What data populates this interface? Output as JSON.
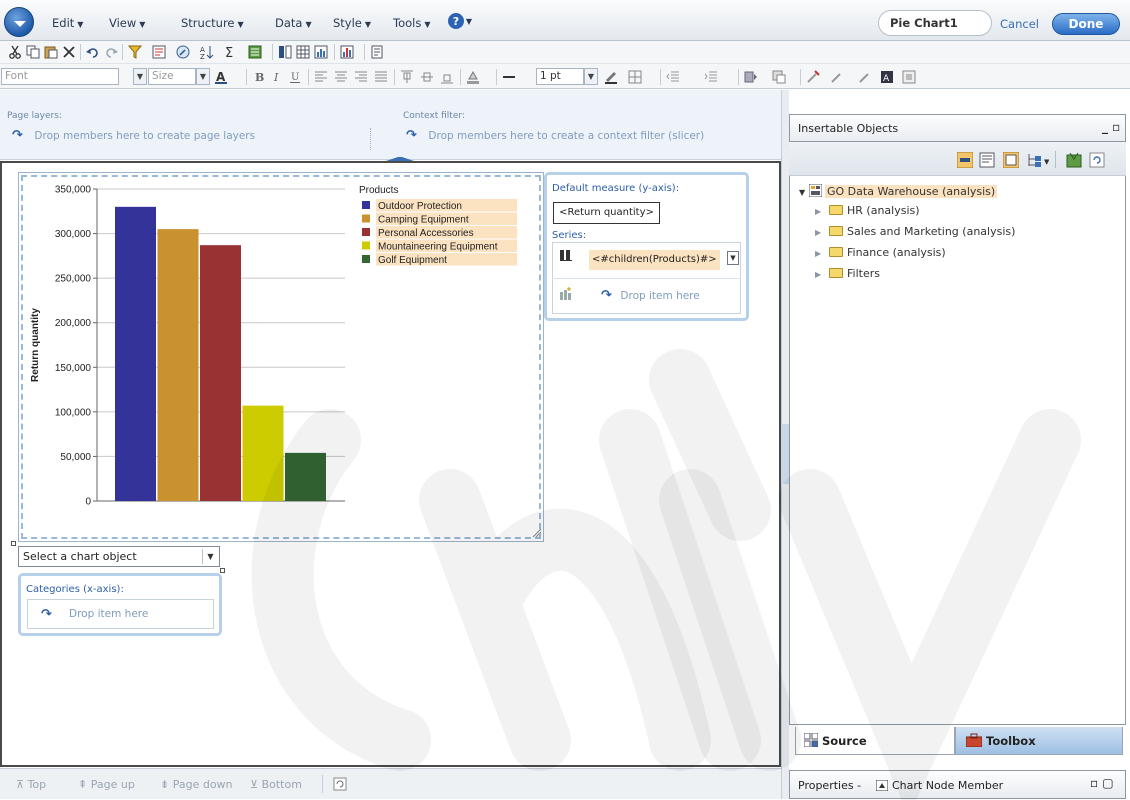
{
  "menu": {
    "items": [
      "Edit",
      "View",
      "Structure",
      "Data",
      "Style",
      "Tools"
    ],
    "help_icon": "help-icon",
    "report_title": "Pie Chart1",
    "cancel_label": "Cancel",
    "done_label": "Done"
  },
  "format_toolbar": {
    "font_placeholder": "Font",
    "size_placeholder": "Size",
    "line_width": "1 pt"
  },
  "layers": {
    "page_layers_label": "Page layers:",
    "page_layers_hint": "Drop members here to create page layers",
    "context_filter_label": "Context filter:",
    "context_filter_hint": "Drop members here to create a context filter (slicer)"
  },
  "chart_panel": {
    "measure_label": "Default measure (y-axis):",
    "measure_value": "<Return quantity>",
    "series_label": "Series:",
    "series_value": "<#children(Products)#>",
    "series_drop": "Drop item here",
    "chart_object_select": "Select a chart object",
    "categories_label": "Categories (x-axis):",
    "categories_drop": "Drop item here"
  },
  "chart_data": {
    "type": "bar",
    "ylabel": "Return quantity",
    "ylim": [
      0,
      350000
    ],
    "yticks": [
      "350,000",
      "300,000",
      "250,000",
      "200,000",
      "150,000",
      "100,000",
      "50,000",
      "0"
    ],
    "legend_title": "Products",
    "legend_position": "top-right",
    "grid": true,
    "series": [
      {
        "name": "Outdoor Protection",
        "value": 330000,
        "color": "#333399"
      },
      {
        "name": "Camping Equipment",
        "value": 305000,
        "color": "#c9922e"
      },
      {
        "name": "Personal Accessories",
        "value": 287000,
        "color": "#993333"
      },
      {
        "name": "Mountaineering Equipment",
        "value": 107000,
        "color": "#cccc00"
      },
      {
        "name": "Golf Equipment",
        "value": 54000,
        "color": "#336633"
      }
    ]
  },
  "pagination": {
    "top": "Top",
    "page_up": "Page up",
    "page_down": "Page down",
    "bottom": "Bottom"
  },
  "insertable": {
    "title": "Insertable Objects",
    "tree": [
      {
        "label": "GO Data Warehouse (analysis)",
        "expanded": true
      },
      {
        "label": "HR (analysis)"
      },
      {
        "label": "Sales and Marketing (analysis)"
      },
      {
        "label": "Finance (analysis)"
      },
      {
        "label": "Filters"
      }
    ],
    "tab_source": "Source",
    "tab_toolbox": "Toolbox"
  },
  "properties": {
    "title": "Properties -",
    "selection": "Chart Node Member"
  },
  "colors": {
    "accent": "#2a6cc6",
    "selection_highlight": "#fbe2c0"
  }
}
